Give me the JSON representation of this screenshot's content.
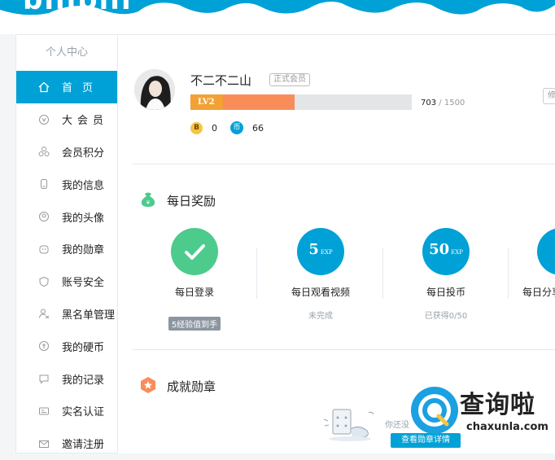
{
  "header": {
    "logo": "bilibili"
  },
  "sidebar": {
    "title": "个人中心",
    "items": [
      {
        "label": "首页",
        "icon": "home-icon",
        "active": true
      },
      {
        "label": "大会员",
        "icon": "vip-icon",
        "active": false
      },
      {
        "label": "会员积分",
        "icon": "points-icon",
        "active": false
      },
      {
        "label": "我的信息",
        "icon": "user-info-icon",
        "active": false
      },
      {
        "label": "我的头像",
        "icon": "avatar-icon",
        "active": false
      },
      {
        "label": "我的勋章",
        "icon": "medal-icon",
        "active": false
      },
      {
        "label": "账号安全",
        "icon": "shield-icon",
        "active": false
      },
      {
        "label": "黑名单管理",
        "icon": "blacklist-icon",
        "active": false
      },
      {
        "label": "我的硬币",
        "icon": "coin-icon",
        "active": false
      },
      {
        "label": "我的记录",
        "icon": "record-icon",
        "active": false
      },
      {
        "label": "实名认证",
        "icon": "id-card-icon",
        "active": false
      },
      {
        "label": "邀请注册",
        "icon": "invite-icon",
        "active": false
      }
    ]
  },
  "profile": {
    "username": "不二不二山",
    "member_tag": "正式会员",
    "level": "LV2",
    "exp_current": "703",
    "exp_sep": "/",
    "exp_max": "1500",
    "exp_progress": 0.469,
    "bcoin_symbol": "B",
    "bcoin": "0",
    "coin_symbol": "币",
    "coins": "66",
    "edge_button": "修"
  },
  "daily_rewards": {
    "title": "每日奖励",
    "tasks": [
      {
        "name": "每日登录",
        "status": "5经验值到手",
        "done": true
      },
      {
        "name": "每日观看视频",
        "status": "未完成",
        "value": "5",
        "unit": "EXP"
      },
      {
        "name": "每日投币",
        "status": "已获得0/50",
        "value": "50",
        "unit": "EXP"
      },
      {
        "name": "每日分享",
        "status": ""
      }
    ]
  },
  "achievements": {
    "title": "成就勋章",
    "empty_text": "你还没",
    "button": "查看勋章详情"
  },
  "watermark": {
    "name": "查询啦",
    "url": "chaxunla.com"
  },
  "colors": {
    "accent": "#00a1d6",
    "green": "#4ccb8c",
    "orange": "#f98d5a"
  }
}
